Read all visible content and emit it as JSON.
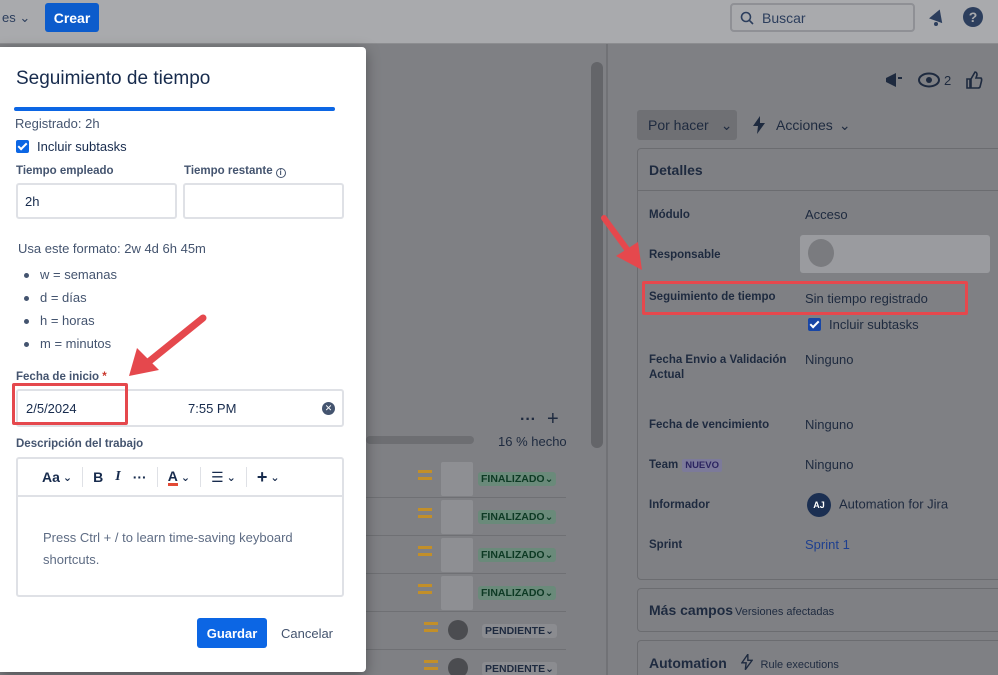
{
  "topbar": {
    "menu_label": "es",
    "create_label": "Crear",
    "search_placeholder": "Buscar"
  },
  "modal": {
    "title": "Seguimiento de tiempo",
    "registered": "Registrado: 2h",
    "include_subtasks": "Incluir subtasks",
    "time_spent_label": "Tiempo empleado",
    "time_spent_value": "2h",
    "time_remaining_label": "Tiempo restante",
    "time_remaining_value": "",
    "format_hint": "Usa este formato: 2w 4d 6h 45m",
    "format_items": [
      "w = semanas",
      "d = días",
      "h = horas",
      "m = minutos"
    ],
    "start_date_label": "Fecha de inicio",
    "required_mark": "*",
    "start_date": "2/5/2024",
    "start_time": "7:55 PM",
    "work_description_label": "Descripción del trabajo",
    "editor_placeholder": "Press Ctrl + / to learn time-saving keyboard shortcuts.",
    "toolbar": {
      "text_style": "Aa",
      "bold": "B",
      "italic": "I",
      "more": "···",
      "color": "A",
      "list": "☰",
      "insert": "+"
    },
    "save_label": "Guardar",
    "cancel_label": "Cancelar"
  },
  "middle": {
    "progress_text": "16 % hecho",
    "progress_fraction": 0.16,
    "more": "···",
    "add": "+",
    "rows": [
      {
        "status": "FINALIZADO"
      },
      {
        "status": "FINALIZADO"
      },
      {
        "status": "FINALIZADO"
      },
      {
        "status": "FINALIZADO"
      },
      {
        "status": "PENDIENTE"
      },
      {
        "status": "PENDIENTE"
      }
    ]
  },
  "right": {
    "watchers_count": "2",
    "status_button": "Por hacer",
    "actions_button": "Acciones",
    "details_title": "Detalles",
    "fields": {
      "modulo_label": "Módulo",
      "modulo_value": "Acceso",
      "responsable_label": "Responsable",
      "tracking_label": "Seguimiento de tiempo",
      "tracking_value": "Sin tiempo registrado",
      "include_subtasks": "Incluir subtasks",
      "fecha_envio_label": "Fecha Envio a Validación Actual",
      "fecha_envio_value": "Ninguno",
      "vencimiento_label": "Fecha de vencimiento",
      "vencimiento_value": "Ninguno",
      "team_label": "Team",
      "team_badge": "NUEVO",
      "team_value": "Ninguno",
      "informador_label": "Informador",
      "informador_initials": "AJ",
      "informador_value": "Automation for Jira",
      "sprint_label": "Sprint",
      "sprint_value": "Sprint 1"
    },
    "more_fields_title": "Más campos",
    "more_fields_sub": "Versiones afectadas",
    "automation_title": "Automation",
    "automation_sub": "Rule executions"
  }
}
